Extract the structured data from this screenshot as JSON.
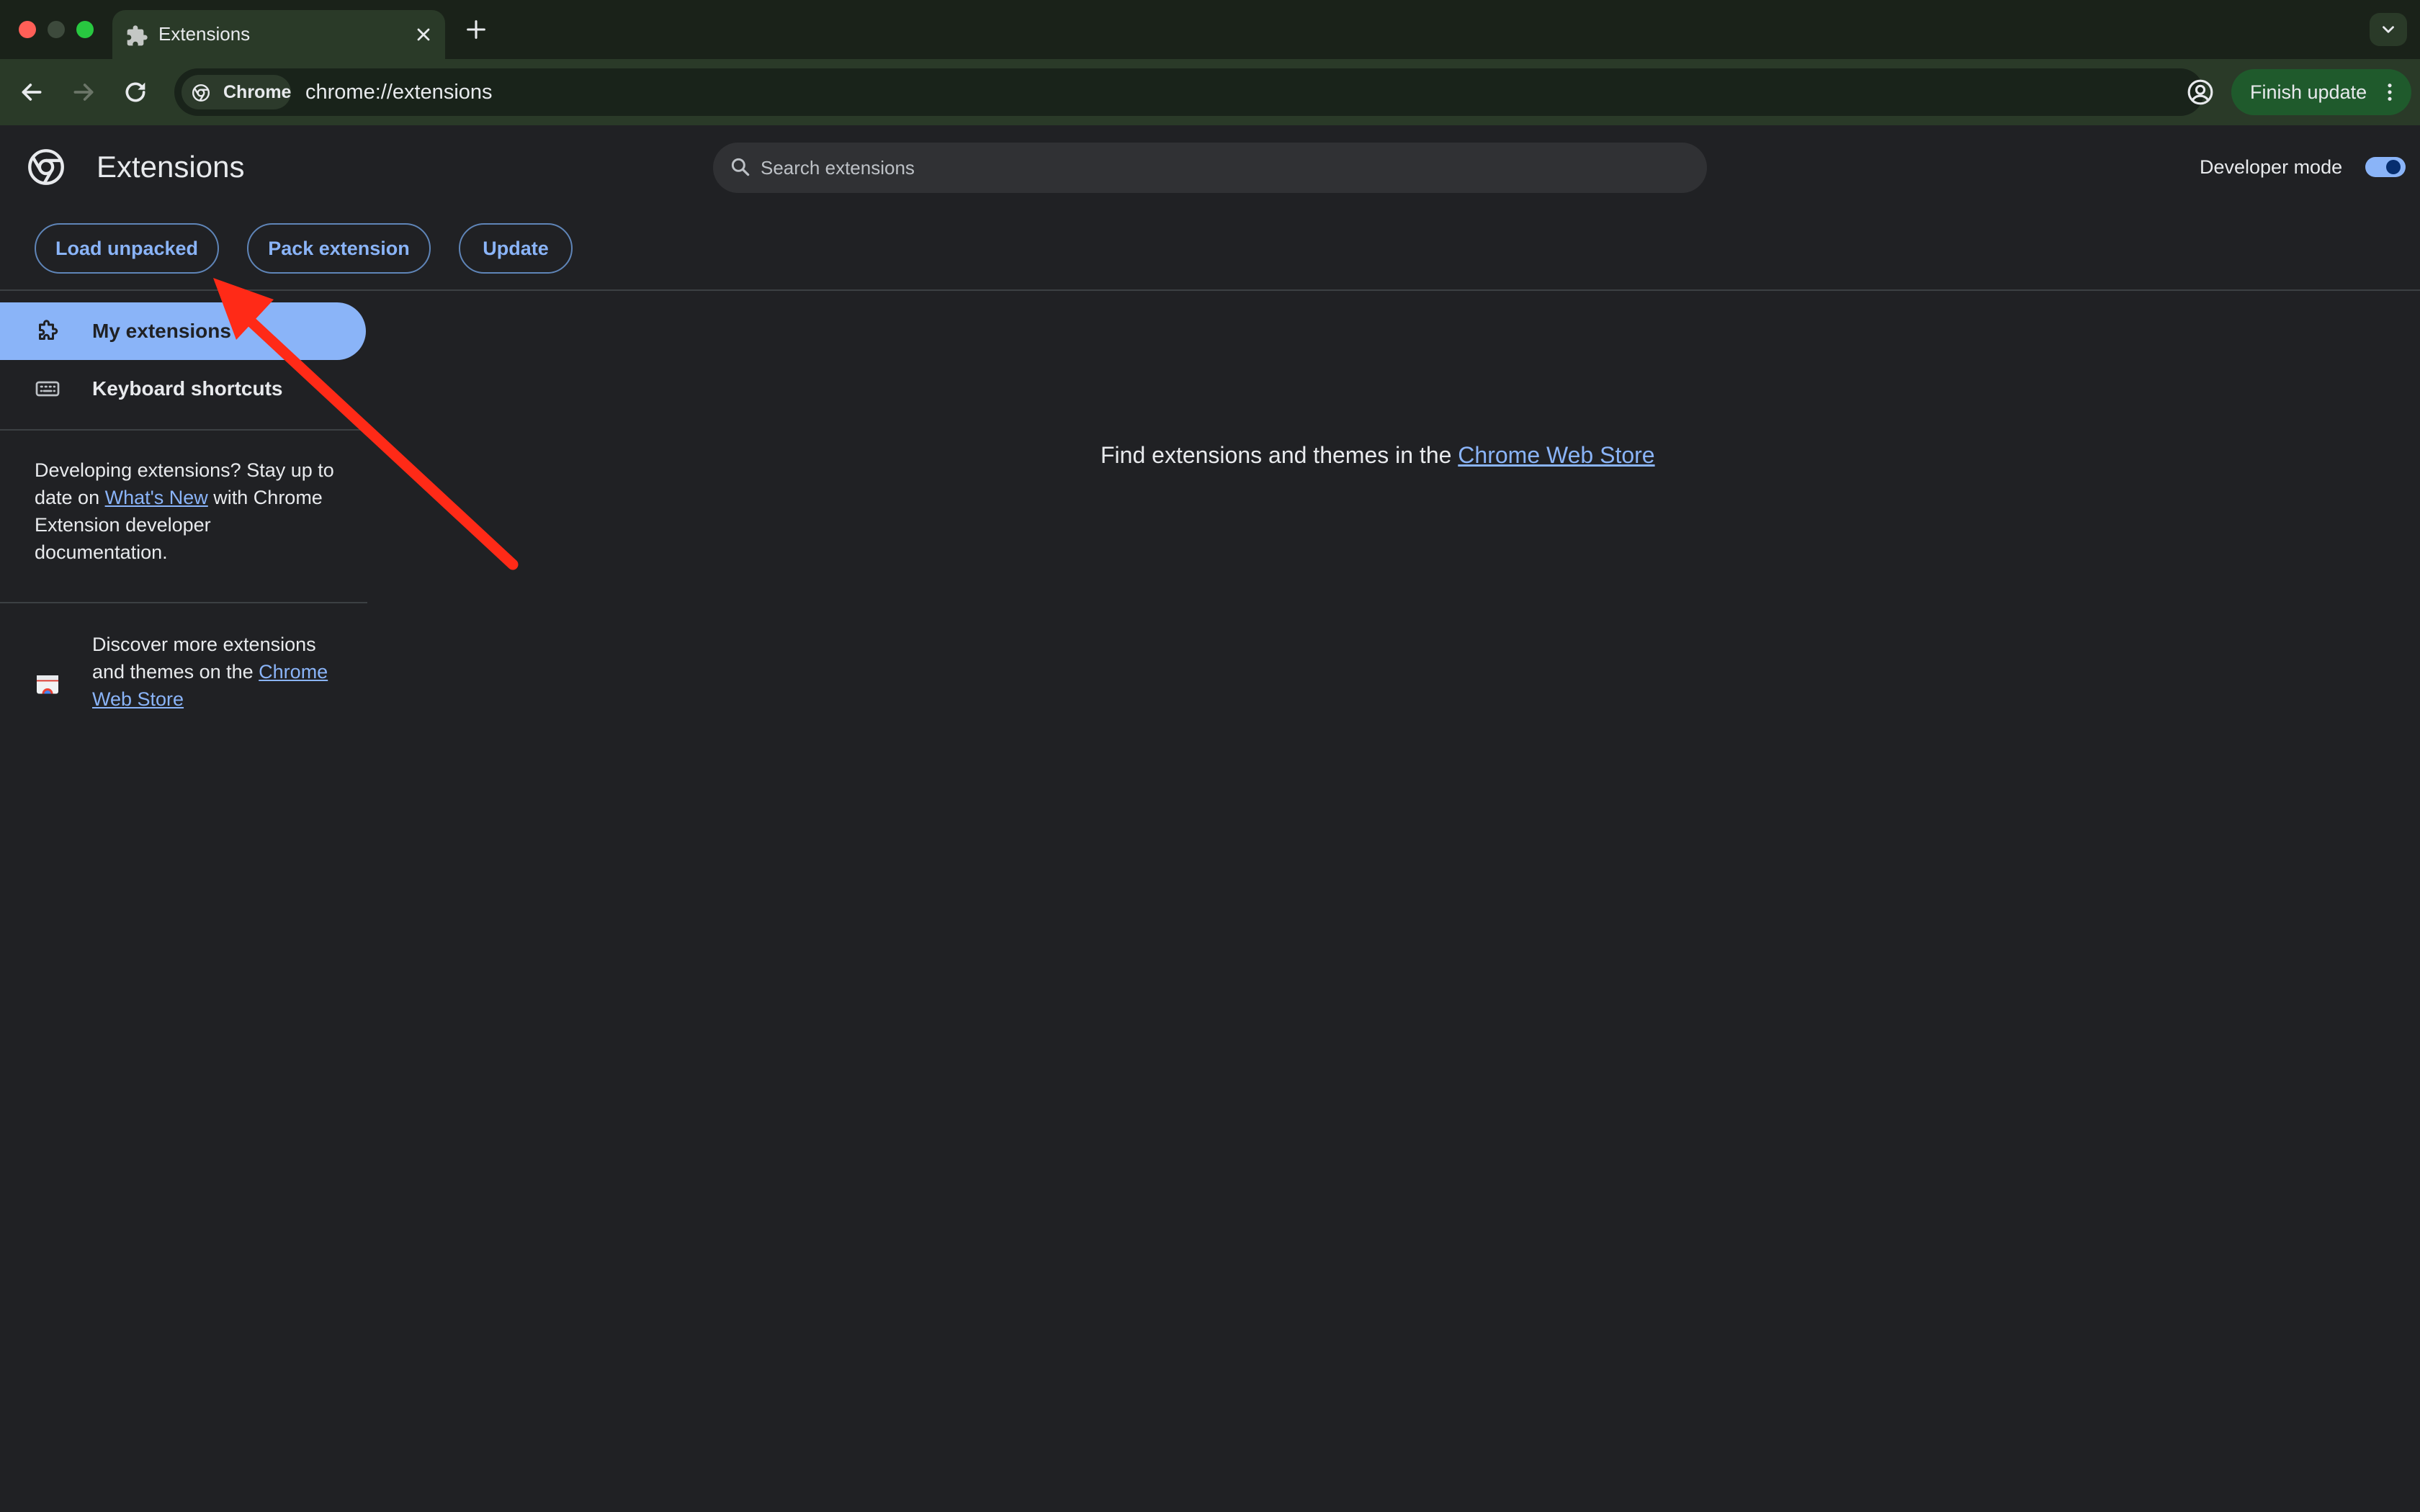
{
  "tab": {
    "title": "Extensions",
    "icon": "puzzle-icon"
  },
  "toolbar": {
    "chip_label": "Chrome",
    "url": "chrome://extensions",
    "finish_update_label": "Finish update"
  },
  "header": {
    "title": "Extensions",
    "search_placeholder": "Search extensions",
    "developer_mode_label": "Developer mode",
    "developer_mode_on": true
  },
  "actions": {
    "load_unpacked": "Load unpacked",
    "pack_extension": "Pack extension",
    "update": "Update"
  },
  "sidebar": {
    "items": [
      {
        "label": "My extensions",
        "icon": "extensions-icon",
        "active": true
      },
      {
        "label": "Keyboard shortcuts",
        "icon": "keyboard-icon",
        "active": false
      }
    ],
    "developing": {
      "before": "Developing extensions? Stay up to date on ",
      "link": "What's New",
      "after": " with Chrome Extension developer documentation."
    },
    "discover": {
      "before": "Discover more extensions and themes on the ",
      "link": "Chrome Web Store"
    }
  },
  "main": {
    "message": "Find extensions and themes in the ",
    "link": "Chrome Web Store"
  },
  "colors": {
    "accent": "#8ab4f8",
    "background": "#202124",
    "annotation_arrow": "#ff2a17"
  }
}
